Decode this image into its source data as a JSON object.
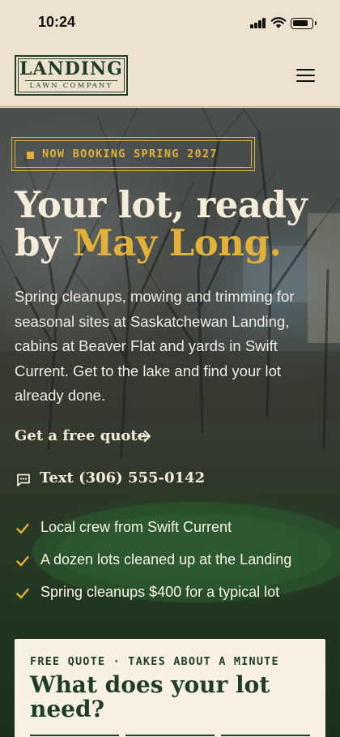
{
  "status_bar": {
    "time": "10:24"
  },
  "header": {
    "logo_main": "LANDING",
    "logo_sub": "LAWN COMPANY",
    "menu_icon": "hamburger-menu-icon"
  },
  "hero": {
    "badge": "NOW BOOKING SPRING 2027",
    "headline_part1": "Your lot, ready by ",
    "headline_accent": "May Long.",
    "lede": "Spring cleanups, mowing and trimming for seasonal sites at Saskatchewan Landing, cabins at Beaver Flat and yards in Swift Current. Get to the lake and find your lot already done.",
    "cta_label": "Get a free quote",
    "text_label": "Text (306) 555-0142",
    "checks": [
      "Local crew from Swift Current",
      "A dozen lots cleaned up at the Landing",
      "Spring cleanups $400 for a typical lot"
    ]
  },
  "quote_card": {
    "kicker": "FREE QUOTE · TAKES ABOUT A MINUTE",
    "title": "What does your lot need?"
  },
  "colors": {
    "accent": "#e2b13a",
    "brand_green": "#1f3d2a",
    "cream": "#ece2cd"
  }
}
